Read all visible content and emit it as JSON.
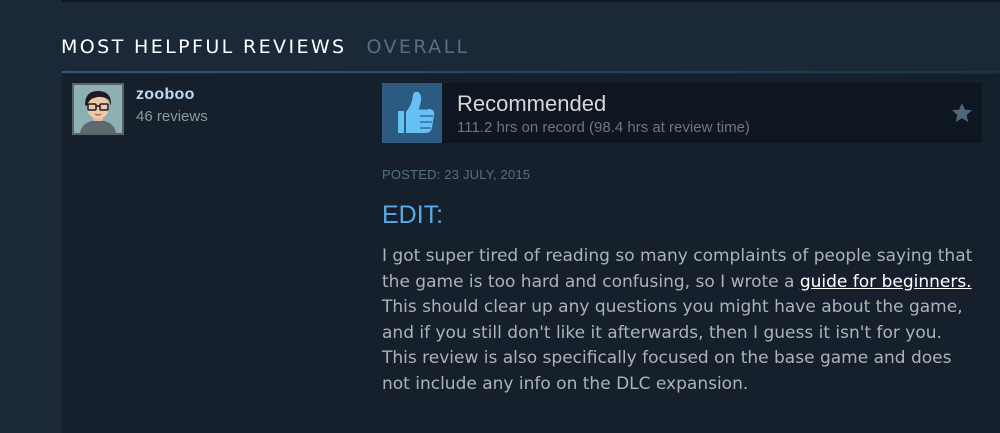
{
  "tabs": {
    "active_label": "MOST HELPFUL REVIEWS",
    "inactive_label": "OVERALL"
  },
  "review": {
    "author": {
      "name": "zooboo",
      "review_count": "46 reviews"
    },
    "vote": {
      "label": "Recommended",
      "hours": "111.2 hrs on record (98.4 hrs at review time)",
      "icon": "thumbs-up-icon"
    },
    "posted": "POSTED: 23 JULY, 2015",
    "heading": "EDIT:",
    "body": {
      "part1": "I got super tired of reading so many complaints of people saying that the game is too hard and confusing, so I wrote a ",
      "link_text": "guide for beginners.",
      "part2": " This should clear up any questions you might have about the game, and if you still don't like it afterwards, then I guess it isn't for you. This review is also specifically focused on the base game and does not include any info on the DLC expansion."
    }
  },
  "colors": {
    "background": "#1b2838",
    "card": "#16202d",
    "accent_blue": "#5aa9e6",
    "thumb_bg": "#2d5a80"
  }
}
